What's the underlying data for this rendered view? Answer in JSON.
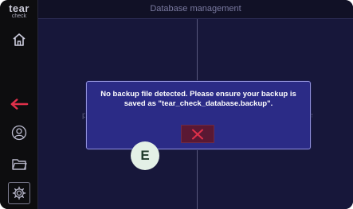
{
  "app": {
    "logo_line1": "tear",
    "logo_line2": "check"
  },
  "header": {
    "title": "Database management"
  },
  "sidebar": {
    "items": [
      {
        "icon": "home-icon"
      },
      {
        "icon": "back-arrow-icon"
      },
      {
        "icon": "user-icon"
      },
      {
        "icon": "folder-icon"
      },
      {
        "icon": "settings-icon"
      }
    ]
  },
  "background": {
    "left_fragment": "p",
    "right_fragment": "e"
  },
  "dialog": {
    "message": "No backup file detected. Please ensure your backup is saved as \"tear_check_database.backup\".",
    "close_icon": "close-icon"
  },
  "annotation": {
    "label": "E"
  },
  "colors": {
    "accent_red": "#e0304a",
    "dialog_bg": "#2b2b86",
    "main_bg": "#17173a"
  }
}
